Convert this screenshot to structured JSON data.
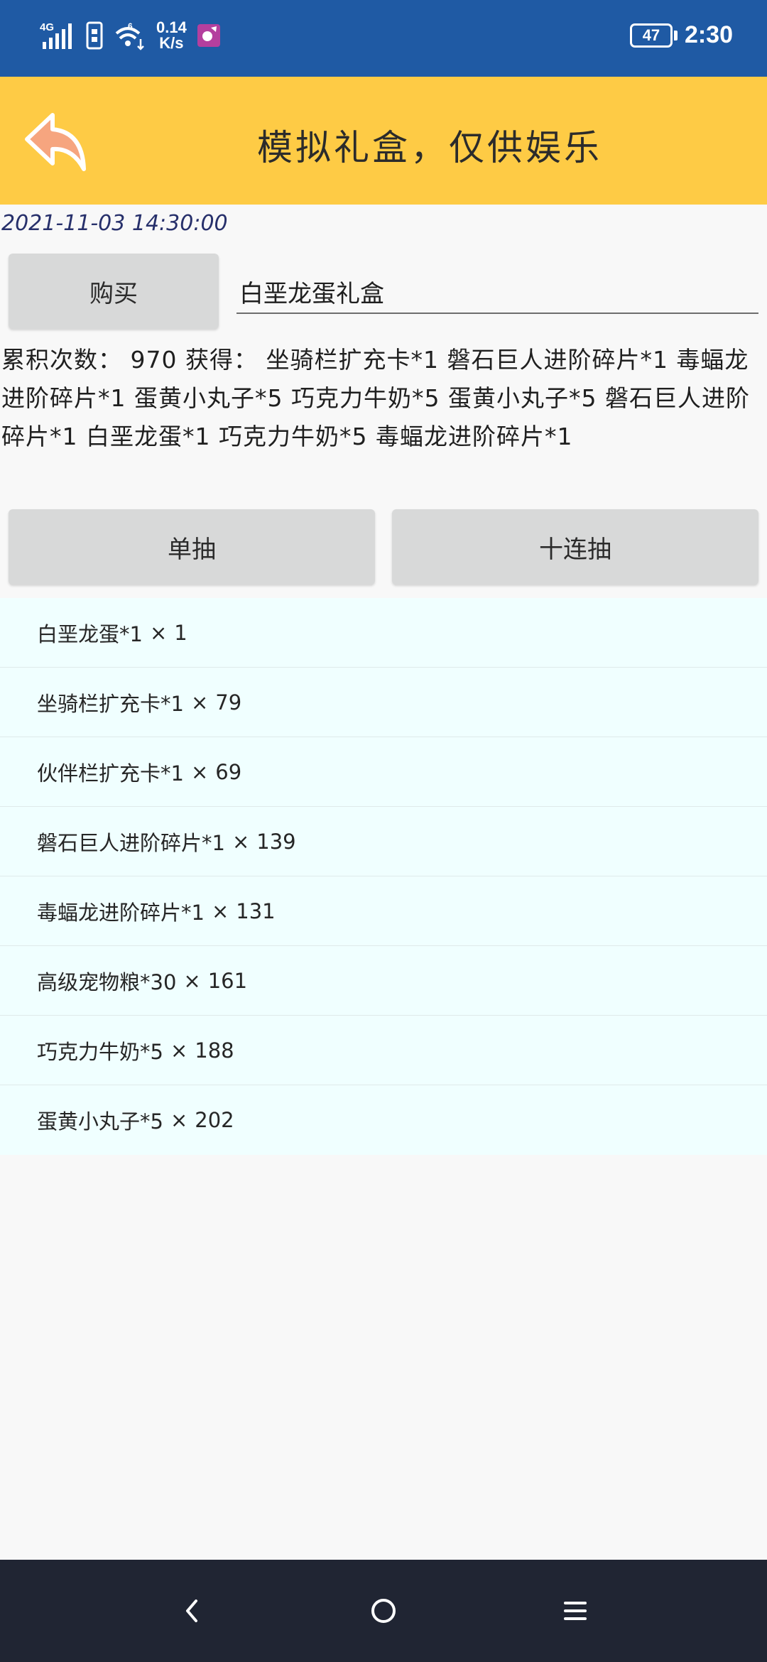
{
  "status_bar": {
    "network": "4G",
    "sim_slot": "6",
    "speed_value": "0.14",
    "speed_unit": "K/s",
    "battery": "47",
    "time": "2:30"
  },
  "header": {
    "title": "模拟礼盒，仅供娱乐"
  },
  "timestamp": "2021-11-03 14:30:00",
  "buy_button_label": "购买",
  "giftbox_input_value": "白垩龙蛋礼盒",
  "summary": "累积次数： 970 获得：  坐骑栏扩充卡*1 磐石巨人进阶碎片*1 毒蝠龙进阶碎片*1 蛋黄小丸子*5 巧克力牛奶*5 蛋黄小丸子*5 磐石巨人进阶碎片*1 白垩龙蛋*1 巧克力牛奶*5 毒蝠龙进阶碎片*1",
  "draw_buttons": {
    "single": "单抽",
    "ten": "十连抽"
  },
  "results": [
    {
      "item": "白垩龙蛋*1",
      "count": "1"
    },
    {
      "item": "坐骑栏扩充卡*1",
      "count": "79"
    },
    {
      "item": "伙伴栏扩充卡*1",
      "count": "69"
    },
    {
      "item": "磐石巨人进阶碎片*1",
      "count": "139"
    },
    {
      "item": "毒蝠龙进阶碎片*1",
      "count": "131"
    },
    {
      "item": "高级宠物粮*30",
      "count": "161"
    },
    {
      "item": "巧克力牛奶*5",
      "count": "188"
    },
    {
      "item": "蛋黄小丸子*5",
      "count": "202"
    }
  ],
  "result_separator": "×",
  "colors": {
    "status_bar_bg": "#1f5aa4",
    "header_bg": "#fecb45",
    "button_bg": "#d8d9d9",
    "results_bg": "#f0ffff",
    "nav_bar_bg": "#202533",
    "timestamp_text": "#27306b"
  },
  "icons": {
    "back": "reply-arrow-icon",
    "nav_back": "chevron-left-icon",
    "nav_home": "circle-home-icon",
    "nav_menu": "hamburger-menu-icon"
  }
}
